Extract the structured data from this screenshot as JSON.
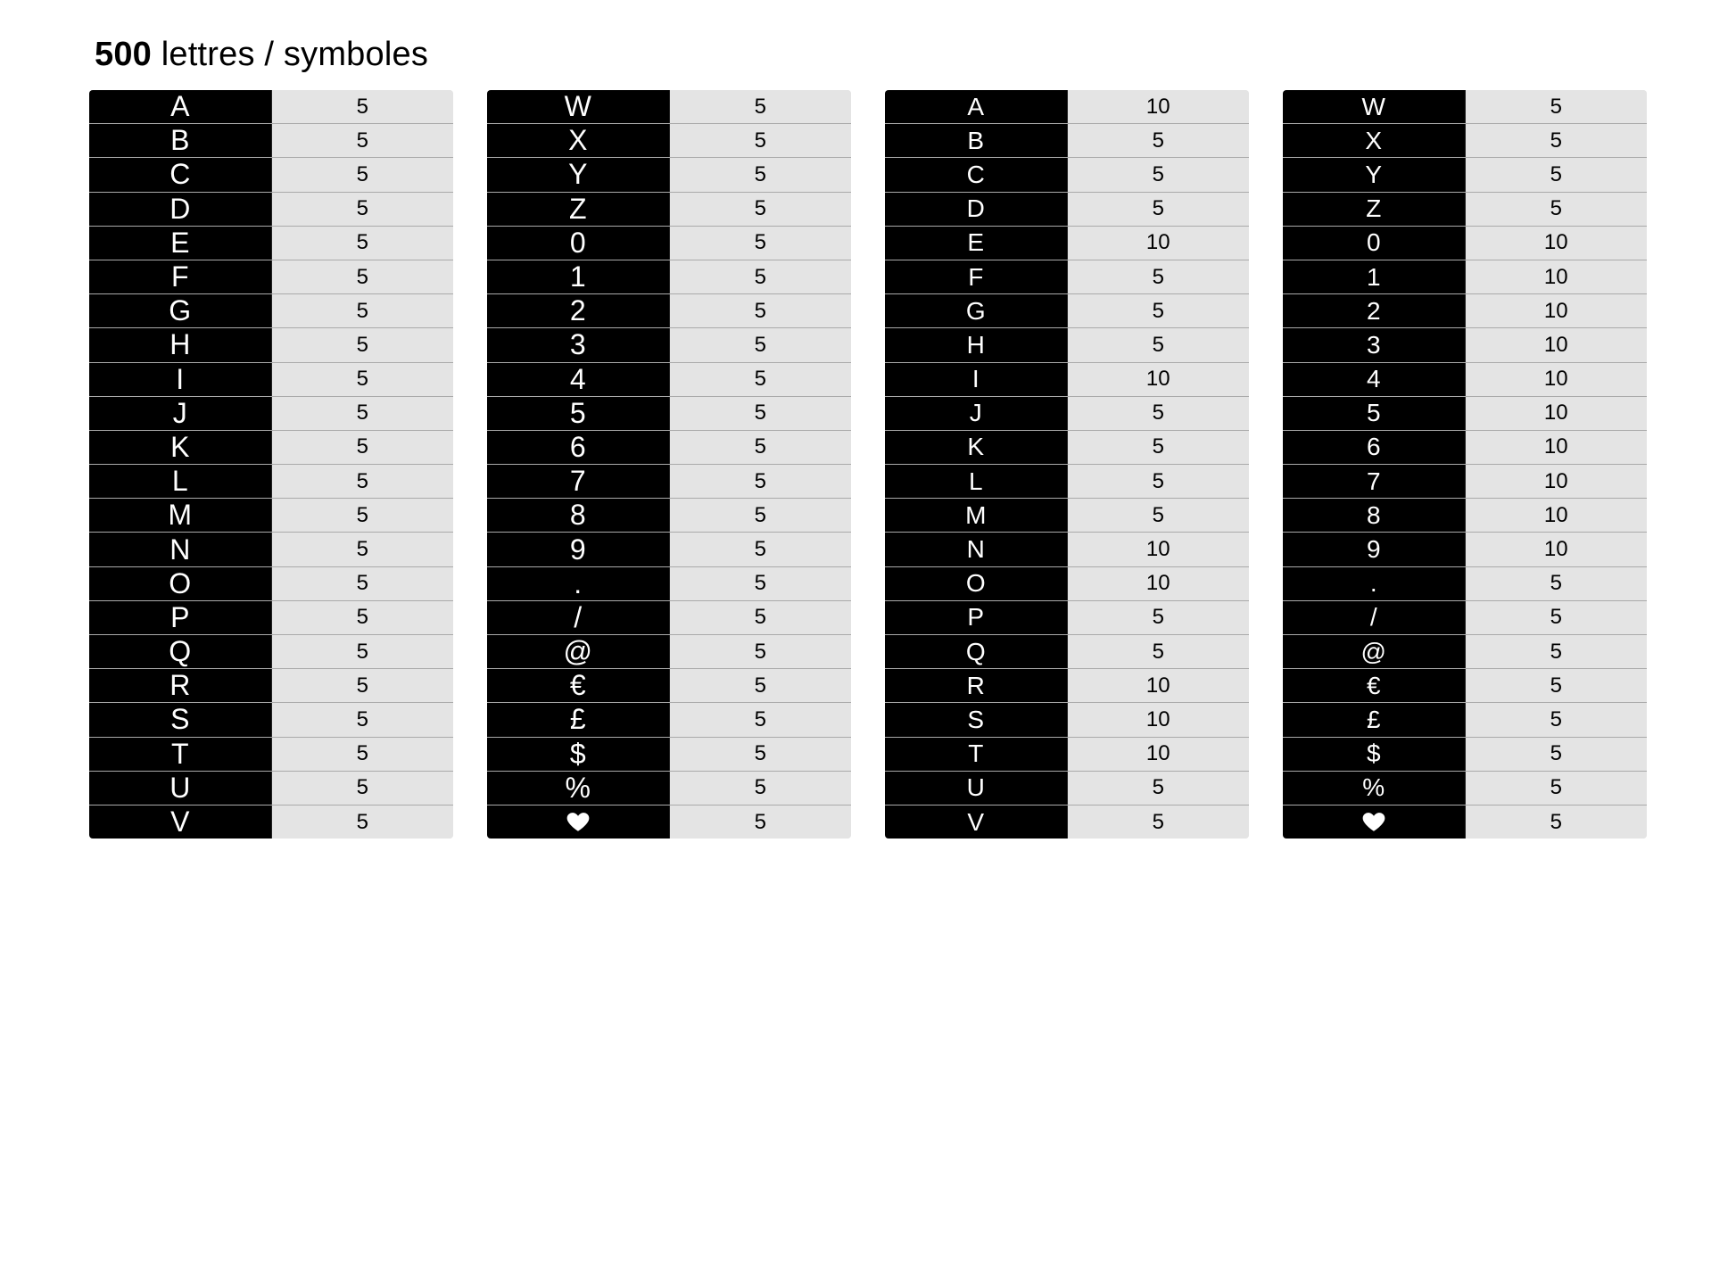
{
  "title_count": "500",
  "title_rest": " lettres / symboles",
  "columns": [
    {
      "big": true,
      "rows": [
        {
          "symbol": "A",
          "count": "5"
        },
        {
          "symbol": "B",
          "count": "5"
        },
        {
          "symbol": "C",
          "count": "5"
        },
        {
          "symbol": "D",
          "count": "5"
        },
        {
          "symbol": "E",
          "count": "5"
        },
        {
          "symbol": "F",
          "count": "5"
        },
        {
          "symbol": "G",
          "count": "5"
        },
        {
          "symbol": "H",
          "count": "5"
        },
        {
          "symbol": "I",
          "count": "5"
        },
        {
          "symbol": "J",
          "count": "5"
        },
        {
          "symbol": "K",
          "count": "5"
        },
        {
          "symbol": "L",
          "count": "5"
        },
        {
          "symbol": "M",
          "count": "5"
        },
        {
          "symbol": "N",
          "count": "5"
        },
        {
          "symbol": "O",
          "count": "5"
        },
        {
          "symbol": "P",
          "count": "5"
        },
        {
          "symbol": "Q",
          "count": "5"
        },
        {
          "symbol": "R",
          "count": "5"
        },
        {
          "symbol": "S",
          "count": "5"
        },
        {
          "symbol": "T",
          "count": "5"
        },
        {
          "symbol": "U",
          "count": "5"
        },
        {
          "symbol": "V",
          "count": "5"
        }
      ]
    },
    {
      "big": true,
      "rows": [
        {
          "symbol": "W",
          "count": "5"
        },
        {
          "symbol": "X",
          "count": "5"
        },
        {
          "symbol": "Y",
          "count": "5"
        },
        {
          "symbol": "Z",
          "count": "5"
        },
        {
          "symbol": "0",
          "count": "5"
        },
        {
          "symbol": "1",
          "count": "5"
        },
        {
          "symbol": "2",
          "count": "5"
        },
        {
          "symbol": "3",
          "count": "5"
        },
        {
          "symbol": "4",
          "count": "5"
        },
        {
          "symbol": "5",
          "count": "5"
        },
        {
          "symbol": "6",
          "count": "5"
        },
        {
          "symbol": "7",
          "count": "5"
        },
        {
          "symbol": "8",
          "count": "5"
        },
        {
          "symbol": "9",
          "count": "5"
        },
        {
          "symbol": ".",
          "count": "5"
        },
        {
          "symbol": "/",
          "count": "5"
        },
        {
          "symbol": "@",
          "count": "5"
        },
        {
          "symbol": "€",
          "count": "5"
        },
        {
          "symbol": "£",
          "count": "5"
        },
        {
          "symbol": "$",
          "count": "5"
        },
        {
          "symbol": "%",
          "count": "5"
        },
        {
          "symbol": "heart",
          "count": "5",
          "icon": "heart-icon"
        }
      ]
    },
    {
      "big": false,
      "rows": [
        {
          "symbol": "A",
          "count": "10"
        },
        {
          "symbol": "B",
          "count": "5"
        },
        {
          "symbol": "C",
          "count": "5"
        },
        {
          "symbol": "D",
          "count": "5"
        },
        {
          "symbol": "E",
          "count": "10"
        },
        {
          "symbol": "F",
          "count": "5"
        },
        {
          "symbol": "G",
          "count": "5"
        },
        {
          "symbol": "H",
          "count": "5"
        },
        {
          "symbol": "I",
          "count": "10"
        },
        {
          "symbol": "J",
          "count": "5"
        },
        {
          "symbol": "K",
          "count": "5"
        },
        {
          "symbol": "L",
          "count": "5"
        },
        {
          "symbol": "M",
          "count": "5"
        },
        {
          "symbol": "N",
          "count": "10"
        },
        {
          "symbol": "O",
          "count": "10"
        },
        {
          "symbol": "P",
          "count": "5"
        },
        {
          "symbol": "Q",
          "count": "5"
        },
        {
          "symbol": "R",
          "count": "10"
        },
        {
          "symbol": "S",
          "count": "10"
        },
        {
          "symbol": "T",
          "count": "10"
        },
        {
          "symbol": "U",
          "count": "5"
        },
        {
          "symbol": "V",
          "count": "5"
        }
      ]
    },
    {
      "big": false,
      "rows": [
        {
          "symbol": "W",
          "count": "5"
        },
        {
          "symbol": "X",
          "count": "5"
        },
        {
          "symbol": "Y",
          "count": "5"
        },
        {
          "symbol": "Z",
          "count": "5"
        },
        {
          "symbol": "0",
          "count": "10"
        },
        {
          "symbol": "1",
          "count": "10"
        },
        {
          "symbol": "2",
          "count": "10"
        },
        {
          "symbol": "3",
          "count": "10"
        },
        {
          "symbol": "4",
          "count": "10"
        },
        {
          "symbol": "5",
          "count": "10"
        },
        {
          "symbol": "6",
          "count": "10"
        },
        {
          "symbol": "7",
          "count": "10"
        },
        {
          "symbol": "8",
          "count": "10"
        },
        {
          "symbol": "9",
          "count": "10"
        },
        {
          "symbol": ".",
          "count": "5"
        },
        {
          "symbol": "/",
          "count": "5"
        },
        {
          "symbol": "@",
          "count": "5"
        },
        {
          "symbol": "€",
          "count": "5"
        },
        {
          "symbol": "£",
          "count": "5"
        },
        {
          "symbol": "$",
          "count": "5"
        },
        {
          "symbol": "%",
          "count": "5"
        },
        {
          "symbol": "heart",
          "count": "5",
          "icon": "heart-icon"
        }
      ]
    }
  ]
}
